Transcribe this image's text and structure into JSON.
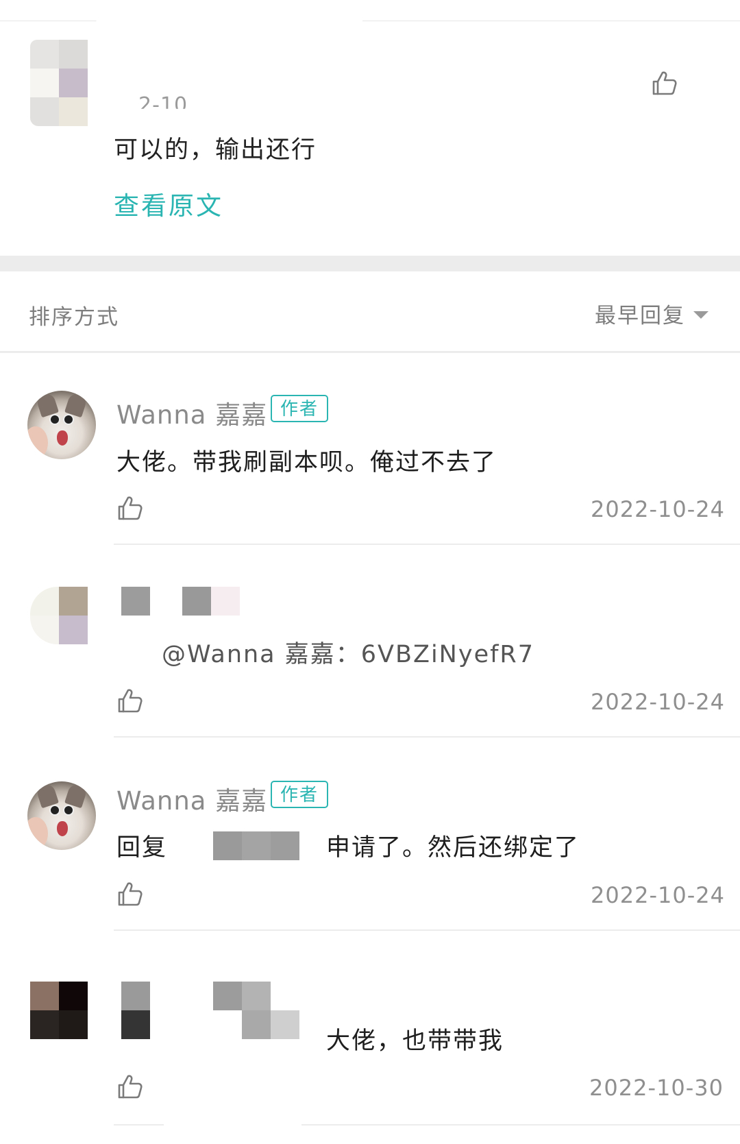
{
  "colors": {
    "accent": "#2bb5b2",
    "muted_text": "#8f8f8f",
    "band": "#ececec"
  },
  "quoted_comment": {
    "date_partial": "2-10",
    "text": "可以的，输出还行",
    "view_original_label": "查看原文",
    "like_icon": "thumbs-up-icon"
  },
  "sort": {
    "label": "排序方式",
    "selected": "最早回复",
    "dropdown_icon": "caret-down-icon"
  },
  "comments": [
    {
      "author": "Wanna 嘉嘉",
      "badge": "作者",
      "text": "大佬。带我刷副本呗。俺过不去了",
      "date": "2022-10-24",
      "like_icon": "thumbs-up-icon"
    },
    {
      "author": "",
      "text": "@Wanna 嘉嘉：6VBZiNyefR7",
      "date": "2022-10-24",
      "like_icon": "thumbs-up-icon"
    },
    {
      "author": "Wanna 嘉嘉",
      "badge": "作者",
      "reply_prefix": "回复",
      "text": "申请了。然后还绑定了",
      "date": "2022-10-24",
      "like_icon": "thumbs-up-icon"
    },
    {
      "author": "",
      "text": "大佬，也带带我",
      "date": "2022-10-30",
      "like_icon": "thumbs-up-icon"
    }
  ]
}
